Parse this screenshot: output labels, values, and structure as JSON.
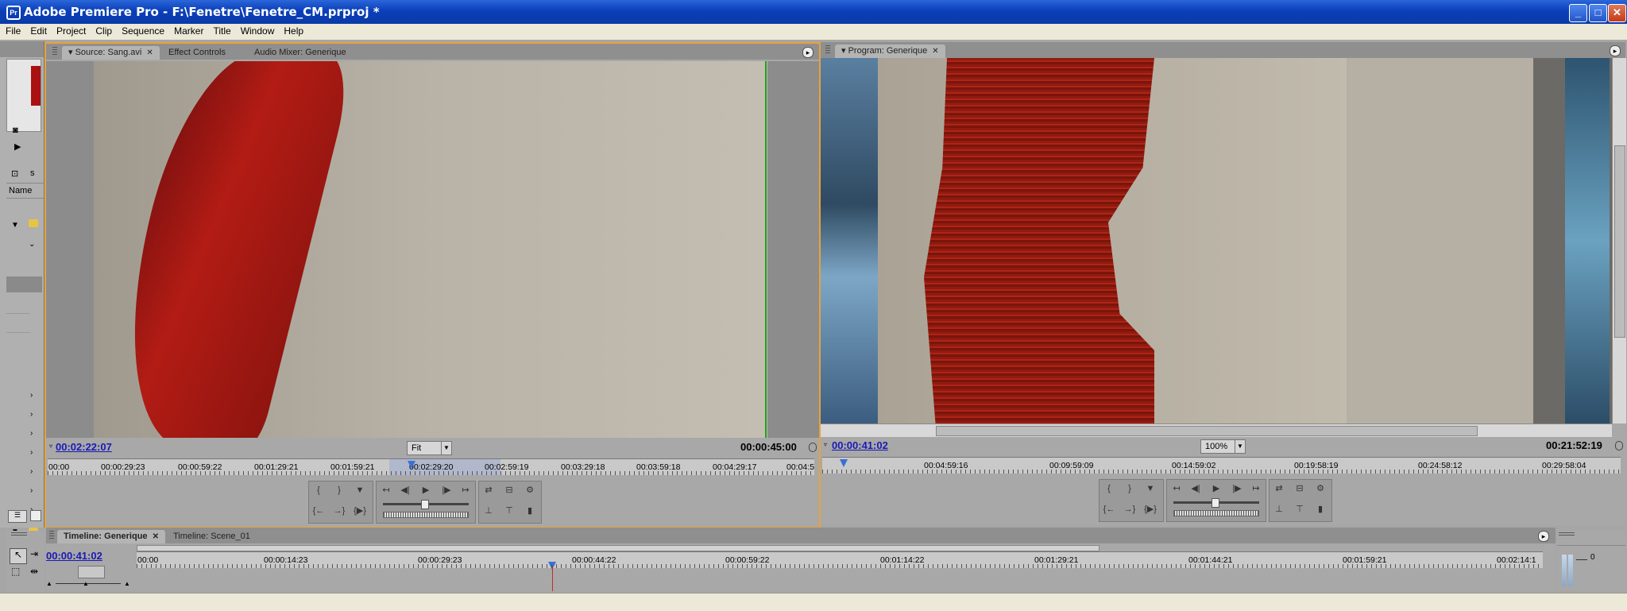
{
  "window": {
    "title": "Adobe Premiere Pro - F:\\Fenetre\\Fenetre_CM.prproj *",
    "app_icon": "Pr"
  },
  "menu": [
    "File",
    "Edit",
    "Project",
    "Clip",
    "Sequence",
    "Marker",
    "Title",
    "Window",
    "Help"
  ],
  "project_panel": {
    "column_header": "Name",
    "label_s": "s"
  },
  "source_monitor": {
    "tabs": [
      "Source: Sang.avi",
      "Effect Controls",
      "Audio Mixer: Generique"
    ],
    "current_tc": "00:02:22:07",
    "zoom": "Fit",
    "duration_tc": "00:00:45:00",
    "ruler": [
      "00:00",
      "00:00:29:23",
      "00:00:59:22",
      "00:01:29:21",
      "00:01:59:21",
      "00:02:29:20",
      "00:02:59:19",
      "00:03:29:18",
      "00:03:59:18",
      "00:04:29:17",
      "00:04:5"
    ]
  },
  "program_monitor": {
    "tab": "Program: Generique",
    "current_tc": "00:00:41:02",
    "zoom": "100%",
    "duration_tc": "00:21:52:19",
    "ruler": [
      "00:04:59:16",
      "00:09:59:09",
      "00:14:59:02",
      "00:19:58:19",
      "00:24:58:12",
      "00:29:58:04"
    ]
  },
  "timeline": {
    "tabs": [
      "Timeline: Generique",
      "Timeline: Scene_01"
    ],
    "current_tc": "00:00:41:02",
    "ruler": [
      "00:00",
      "00:00:14:23",
      "00:00:29:23",
      "00:00:44:22",
      "00:00:59:22",
      "00:01:14:22",
      "00:01:29:21",
      "00:01:44:21",
      "00:01:59:21",
      "00:02:14:1"
    ]
  },
  "audio_meter": {
    "label": "0"
  },
  "colors": {
    "title_bar": "#0a3fb9",
    "active_panel_border": "#e8a23a",
    "timecode_blue": "#1a1ab5"
  }
}
